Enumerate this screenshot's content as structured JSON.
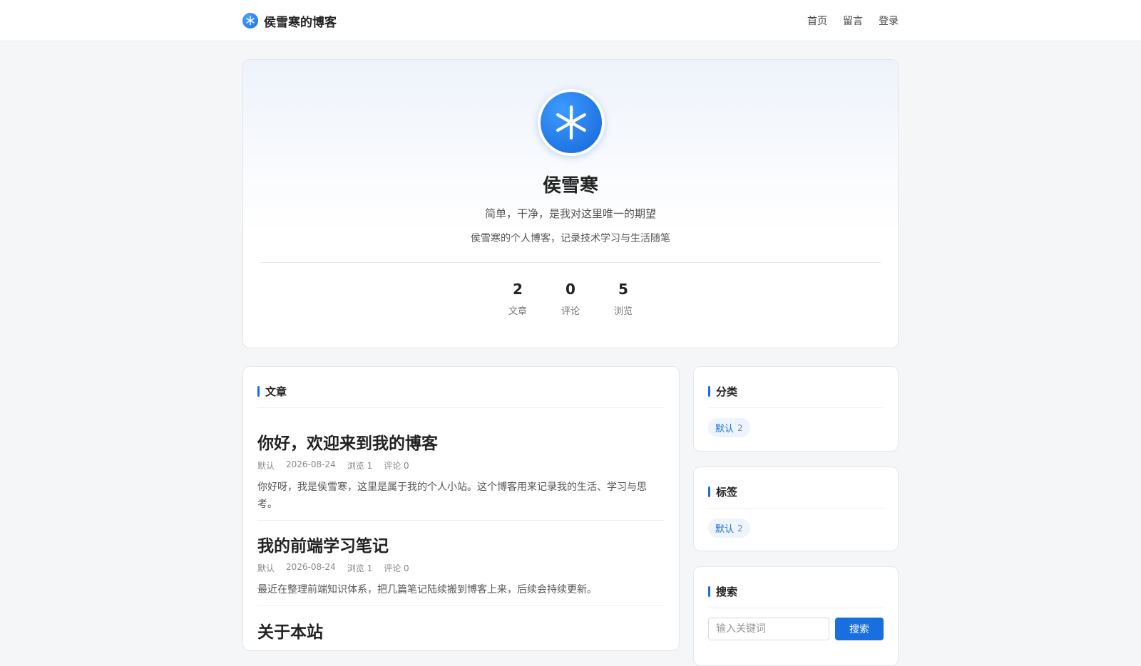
{
  "header": {
    "brand_title": "侯雪寒的博客",
    "nav": [
      "首页",
      "留言",
      "登录"
    ]
  },
  "profile": {
    "name": "侯雪寒",
    "motto": "简单，干净，是我对这里唯一的期望",
    "description": "侯雪寒的个人博客，记录技术学习与生活随笔",
    "stats": [
      {
        "value": "2",
        "label": "文章"
      },
      {
        "value": "0",
        "label": "评论"
      },
      {
        "value": "5",
        "label": "浏览"
      }
    ]
  },
  "articles": {
    "section_title": "文章",
    "posts": [
      {
        "title": "你好，欢迎来到我的博客",
        "category": "默认",
        "date": "2026-08-24",
        "views": "浏览 1",
        "comments": "评论 0",
        "excerpt": "你好呀，我是侯雪寒，这里是属于我的个人小站。这个博客用来记录我的生活、学习与思考。"
      },
      {
        "title": "我的前端学习笔记",
        "category": "默认",
        "date": "2026-08-24",
        "views": "浏览 1",
        "comments": "评论 0",
        "excerpt": "最近在整理前端知识体系，把几篇笔记陆续搬到博客上来，后续会持续更新。"
      },
      {
        "title": "关于本站"
      }
    ]
  },
  "sidebar": {
    "categories": {
      "title": "分类",
      "items": [
        {
          "label": "默认",
          "count": "2"
        }
      ]
    },
    "tags": {
      "title": "标签",
      "items": [
        {
          "label": "默认",
          "count": "2"
        }
      ]
    },
    "search": {
      "title": "搜索",
      "placeholder": "输入关键词",
      "button": "搜索"
    }
  },
  "colors": {
    "accent": "#1a6fe0",
    "background": "#f5f6f8"
  },
  "icons": {
    "brand": "snowflake-icon",
    "avatar": "snowflake-icon"
  }
}
